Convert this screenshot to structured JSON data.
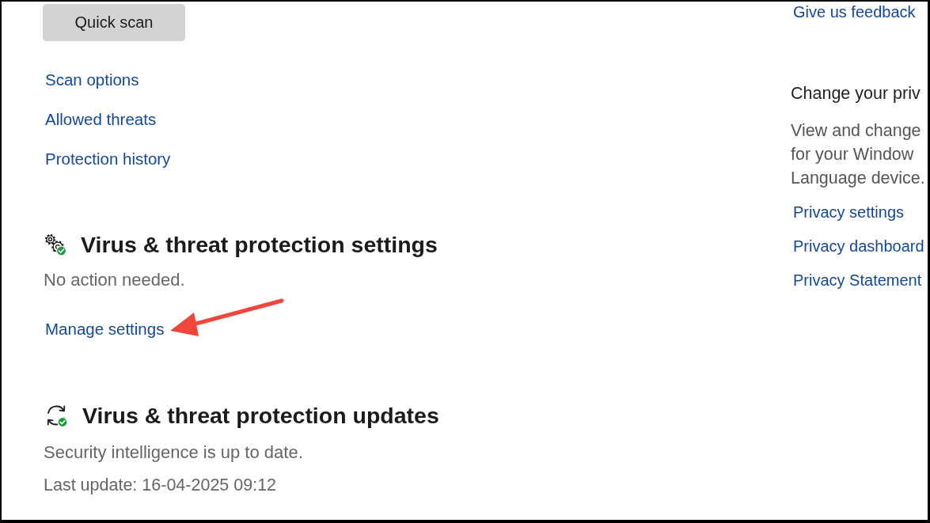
{
  "scan_actions": {
    "button": "Quick scan",
    "links": [
      "Scan options",
      "Allowed threats",
      "Protection history"
    ]
  },
  "sections": [
    {
      "kind": "settings",
      "title": "Virus & threat protection settings",
      "status": "No action needed.",
      "link": {
        "label": "Manage settings",
        "annotated": true
      }
    },
    {
      "kind": "updates",
      "title": "Virus & threat protection updates",
      "status": "Security intelligence is up to date.",
      "detail": "Last update: 16-04-2025 09:12"
    }
  ],
  "side_panel": {
    "feedback_link": "Give us feedback",
    "privacy": {
      "title": "Change your priv",
      "description_lines": [
        "View and change",
        "for your Window",
        "Language device."
      ],
      "links": [
        "Privacy settings",
        "Privacy dashboard",
        "Privacy Statement"
      ]
    }
  }
}
